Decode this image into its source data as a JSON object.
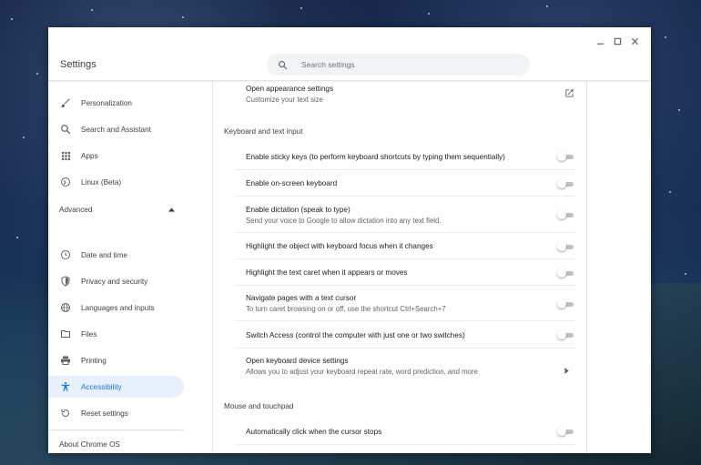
{
  "window": {
    "title": "Settings",
    "controls": [
      "minimize-icon",
      "maximize-icon",
      "close-icon"
    ]
  },
  "search": {
    "placeholder": "Search settings"
  },
  "sidebar": {
    "items": [
      {
        "label": "Personalization",
        "icon": "brush-icon"
      },
      {
        "label": "Search and Assistant",
        "icon": "search-icon"
      },
      {
        "label": "Apps",
        "icon": "apps-grid-icon"
      },
      {
        "label": "Linux (Beta)",
        "icon": "linux-icon"
      }
    ],
    "advanced_label": "Advanced",
    "advanced_items": [
      {
        "label": "Date and time",
        "icon": "clock-icon"
      },
      {
        "label": "Privacy and security",
        "icon": "shield-icon"
      },
      {
        "label": "Languages and inputs",
        "icon": "globe-icon"
      },
      {
        "label": "Files",
        "icon": "folder-icon"
      },
      {
        "label": "Printing",
        "icon": "printer-icon"
      },
      {
        "label": "Accessibility",
        "icon": "accessibility-icon",
        "active": true
      },
      {
        "label": "Reset settings",
        "icon": "reset-icon"
      }
    ],
    "about_label": "About Chrome OS"
  },
  "content": {
    "top_row": {
      "main": "Open appearance settings",
      "sub": "Customize your text size"
    },
    "keyboard_section": {
      "heading": "Keyboard and text input",
      "rows": [
        {
          "main": "Enable sticky keys (to perform keyboard shortcuts by typing them sequentially)",
          "sub": ""
        },
        {
          "main": "Enable on-screen keyboard",
          "sub": ""
        },
        {
          "main": "Enable dictation (speak to type)",
          "sub": "Send your voice to Google to allow dictation into any text field."
        },
        {
          "main": "Highlight the object with keyboard focus when it changes",
          "sub": ""
        },
        {
          "main": "Highlight the text caret when it appears or moves",
          "sub": ""
        },
        {
          "main": "Navigate pages with a text cursor",
          "sub": "To turn caret browsing on or off, use the shortcut Ctrl+Search+7"
        },
        {
          "main": "Switch Access (control the computer with just one or two switches)",
          "sub": ""
        }
      ],
      "device_row": {
        "main": "Open keyboard device settings",
        "sub": "Allows you to adjust your keyboard repeat rate, word prediction, and more"
      }
    },
    "mouse_section": {
      "heading": "Mouse and touchpad",
      "rows": [
        {
          "main": "Automatically click when the cursor stops",
          "sub": ""
        }
      ]
    }
  }
}
